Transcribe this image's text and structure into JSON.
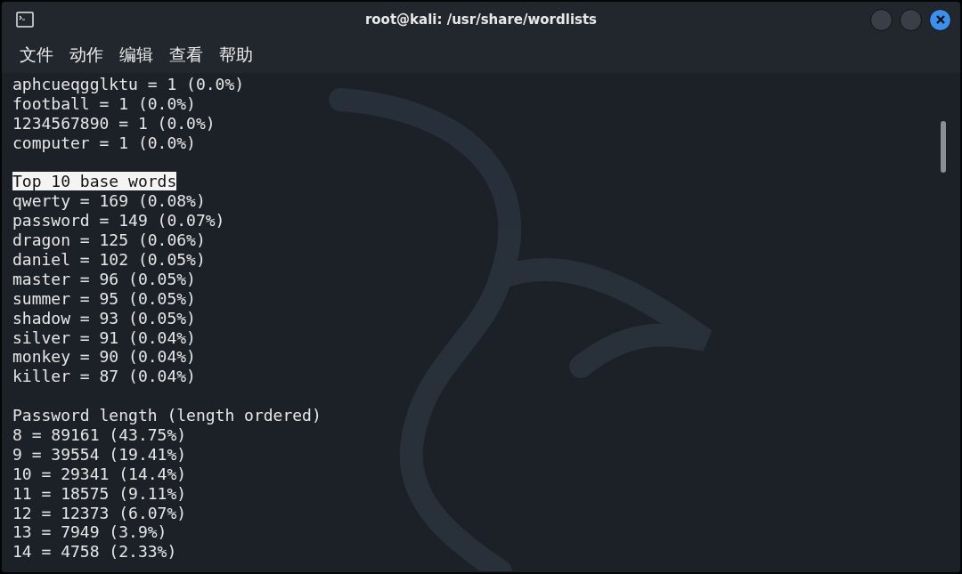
{
  "window": {
    "title": "root@kali: /usr/share/wordlists"
  },
  "menu": [
    "文件",
    "动作",
    "编辑",
    "查看",
    "帮助"
  ],
  "terminal_lines": [
    {
      "kind": "text",
      "text": "aphcueqgglktu = 1 (0.0%)"
    },
    {
      "kind": "text",
      "text": "football = 1 (0.0%)"
    },
    {
      "kind": "text",
      "text": "1234567890 = 1 (0.0%)"
    },
    {
      "kind": "text",
      "text": "computer = 1 (0.0%)"
    },
    {
      "kind": "blank"
    },
    {
      "kind": "highlight",
      "text": "Top 10 base words"
    },
    {
      "kind": "text",
      "text": "qwerty = 169 (0.08%)"
    },
    {
      "kind": "text",
      "text": "password = 149 (0.07%)"
    },
    {
      "kind": "text",
      "text": "dragon = 125 (0.06%)"
    },
    {
      "kind": "text",
      "text": "daniel = 102 (0.05%)"
    },
    {
      "kind": "text",
      "text": "master = 96 (0.05%)"
    },
    {
      "kind": "text",
      "text": "summer = 95 (0.05%)"
    },
    {
      "kind": "text",
      "text": "shadow = 93 (0.05%)"
    },
    {
      "kind": "text",
      "text": "silver = 91 (0.04%)"
    },
    {
      "kind": "text",
      "text": "monkey = 90 (0.04%)"
    },
    {
      "kind": "text",
      "text": "killer = 87 (0.04%)"
    },
    {
      "kind": "blank"
    },
    {
      "kind": "text",
      "text": "Password length (length ordered)"
    },
    {
      "kind": "text",
      "text": "8 = 89161 (43.75%)"
    },
    {
      "kind": "text",
      "text": "9 = 39554 (19.41%)"
    },
    {
      "kind": "text",
      "text": "10 = 29341 (14.4%)"
    },
    {
      "kind": "text",
      "text": "11 = 18575 (9.11%)"
    },
    {
      "kind": "text",
      "text": "12 = 12373 (6.07%)"
    },
    {
      "kind": "text",
      "text": "13 = 7949 (3.9%)"
    },
    {
      "kind": "text",
      "text": "14 = 4758 (2.33%)"
    }
  ]
}
